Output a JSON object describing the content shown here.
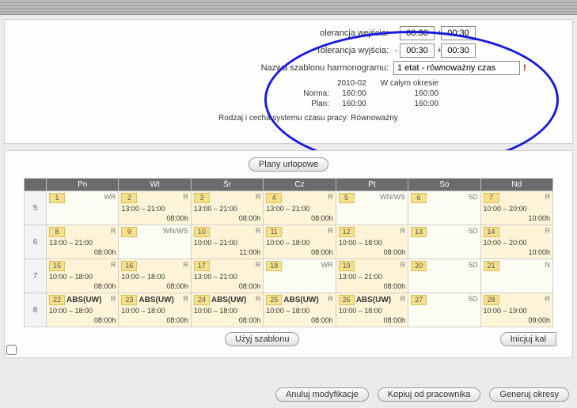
{
  "tolerance_in_label": "olerancja wejścia:",
  "tolerance_out_label": "Tolerancja wyjścia:",
  "tol_in_minus": "00:30",
  "tol_in_plus": "00:30",
  "tol_out_minus": "00:30",
  "tol_out_plus": "00:30",
  "template_label": "Nazwa szablonu harmonogramu:",
  "template_value": "1 etat - równoważny czas",
  "warn": "!",
  "period_current": "2010-02",
  "period_all": "W całym okresie",
  "norm_label": "Norma:",
  "norm_cur": "160:00",
  "norm_all": "160:00",
  "plan_label": "Plan:",
  "plan_cur": "160:00",
  "plan_all": "160:00",
  "system_label": "Rodzaj i cecha systemu czasu pracy:",
  "system_value": "Równoważny",
  "btn_plans": "Plany urlopowe",
  "btn_use_template": "Użyj szablonu",
  "btn_init": "Inicjuj kal",
  "btn_cancel": "Anuluj modyfikacje",
  "btn_copy": "Kopiuj od pracownika",
  "btn_gen": "Generuj okresy",
  "days": [
    "Pn",
    "Wt",
    "Śr",
    "Cz",
    "Pt",
    "So",
    "Nd"
  ],
  "weeks": [
    {
      "no": "5",
      "cells": [
        {
          "d": "1",
          "tag": "WR",
          "type": "off"
        },
        {
          "d": "2",
          "tag": "R",
          "type": "work",
          "t1": "13:00 – 21:00",
          "t2": "08:00h"
        },
        {
          "d": "3",
          "tag": "R",
          "type": "work",
          "t1": "13:00 – 21:00",
          "t2": "08:00h"
        },
        {
          "d": "4",
          "tag": "R",
          "type": "work",
          "t1": "13:00 – 21:00",
          "t2": "08:00h"
        },
        {
          "d": "5",
          "tag": "WN/WS",
          "type": "off"
        },
        {
          "d": "6",
          "tag": "5D",
          "type": "off"
        },
        {
          "d": "7",
          "tag": "R",
          "type": "work",
          "t1": "10:00 – 20:00",
          "t2": "10:00h"
        }
      ]
    },
    {
      "no": "6",
      "cells": [
        {
          "d": "8",
          "tag": "R",
          "type": "work",
          "t1": "13:00 – 21:00",
          "t2": "08:00h"
        },
        {
          "d": "9",
          "tag": "WN/WS",
          "type": "off"
        },
        {
          "d": "10",
          "tag": "R",
          "type": "work",
          "t1": "10:00 – 21:00",
          "t2": "11:00h"
        },
        {
          "d": "11",
          "tag": "R",
          "type": "work",
          "t1": "10:00 – 18:00",
          "t2": "08:00h"
        },
        {
          "d": "12",
          "tag": "R",
          "type": "work",
          "t1": "10:00 – 18:00",
          "t2": "08:00h"
        },
        {
          "d": "13",
          "tag": "5D",
          "type": "off"
        },
        {
          "d": "14",
          "tag": "R",
          "type": "work",
          "t1": "10:00 – 20:00",
          "t2": "10:00h"
        }
      ]
    },
    {
      "no": "7",
      "cells": [
        {
          "d": "15",
          "tag": "R",
          "type": "work",
          "t1": "10:00 – 18:00",
          "t2": "08:00h"
        },
        {
          "d": "16",
          "tag": "R",
          "type": "work",
          "t1": "10:00 – 18:00",
          "t2": "08:00h"
        },
        {
          "d": "17",
          "tag": "R",
          "type": "work",
          "t1": "13:00 – 21:00",
          "t2": "08:00h"
        },
        {
          "d": "18",
          "tag": "WR",
          "type": "off"
        },
        {
          "d": "19",
          "tag": "R",
          "type": "work",
          "t1": "13:00 – 21:00",
          "t2": "08:00h"
        },
        {
          "d": "20",
          "tag": "5D",
          "type": "off"
        },
        {
          "d": "21",
          "tag": "N",
          "type": "off"
        }
      ]
    },
    {
      "no": "8",
      "cells": [
        {
          "d": "22",
          "tag": "R",
          "type": "work",
          "abs": "ABS(UW)",
          "t1": "10:00 – 18:00",
          "t2": "08:00h"
        },
        {
          "d": "23",
          "tag": "R",
          "type": "work",
          "abs": "ABS(UW)",
          "t1": "10:00 – 18:00",
          "t2": "08:00h"
        },
        {
          "d": "24",
          "tag": "R",
          "type": "work",
          "abs": "ABS(UW)",
          "t1": "10:00 – 18:00",
          "t2": "08:00h"
        },
        {
          "d": "25",
          "tag": "R",
          "type": "work",
          "abs": "ABS(UW)",
          "t1": "10:00 – 18:00",
          "t2": "08:00h"
        },
        {
          "d": "26",
          "tag": "R",
          "type": "work",
          "abs": "ABS(UW)",
          "t1": "10:00 – 18:00",
          "t2": "08:00h"
        },
        {
          "d": "27",
          "tag": "5D",
          "type": "off"
        },
        {
          "d": "28",
          "tag": "R",
          "type": "work",
          "t1": "10:00 – 19:00",
          "t2": "09:00h"
        }
      ]
    }
  ]
}
